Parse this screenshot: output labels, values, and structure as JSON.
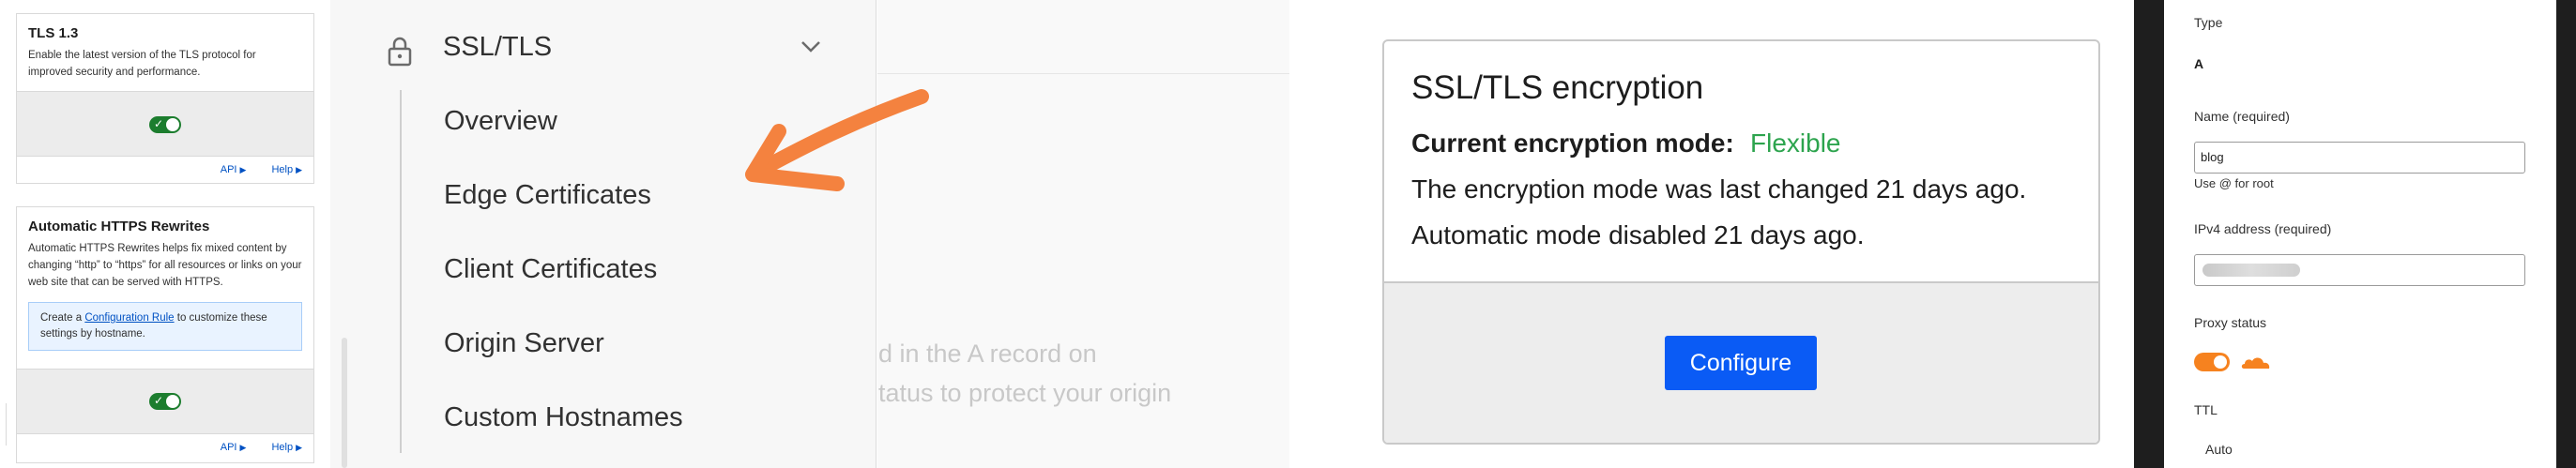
{
  "tls_panel": {
    "cards": [
      {
        "title": "TLS 1.3",
        "description": "Enable the latest version of the TLS protocol for improved security and performance.",
        "api_link": "API",
        "help_link": "Help"
      },
      {
        "title": "Automatic HTTPS Rewrites",
        "description": "Automatic HTTPS Rewrites helps fix mixed content by changing “http” to “https” for all resources or links on your web site that can be served with HTTPS.",
        "info_prefix": "Create a ",
        "info_link": "Configuration Rule",
        "info_suffix": " to customize these settings by hostname.",
        "api_link": "API",
        "help_link": "Help"
      }
    ]
  },
  "nav": {
    "section_title": "SSL/TLS",
    "items": [
      "Overview",
      "Edge Certificates",
      "Client Certificates",
      "Origin Server",
      "Custom Hostnames"
    ],
    "faded_line1": "d in the A record on",
    "faded_line2": "tatus to protect your origin",
    "arrow_color": "#f4823f"
  },
  "encryption": {
    "title": "SSL/TLS encryption",
    "mode_label": "Current encryption mode:",
    "mode_value": "Flexible",
    "changed_text": "The encryption mode was last changed 21 days ago.",
    "automatic_text": "Automatic mode disabled 21 days ago.",
    "configure_button": "Configure",
    "mode_color": "#2da44e",
    "button_color": "#0a5bf5"
  },
  "dns_form": {
    "type_label": "Type",
    "type_value": "A",
    "name_label": "Name (required)",
    "name_value": "blog",
    "name_hint": "Use @ for root",
    "ipv4_label": "IPv4 address (required)",
    "proxy_label": "Proxy status",
    "ttl_label": "TTL",
    "ttl_value": "Auto",
    "proxy_color": "#f6821f"
  }
}
